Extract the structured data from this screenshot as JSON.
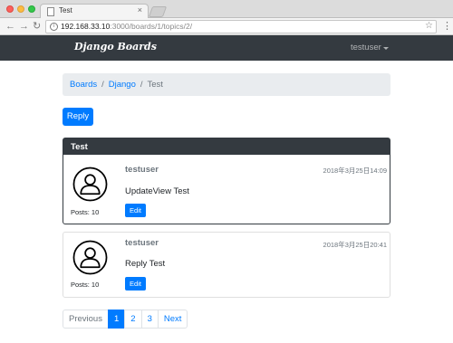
{
  "browser": {
    "tab_title": "Test",
    "tab_close": "×",
    "url_host": "192.168.33.10",
    "url_rest": ":3000/boards/1/topics/2/",
    "back_icon": "arrow-left-icon",
    "forward_icon": "arrow-right-icon",
    "reload_icon": "reload-icon",
    "bookmark_icon": "star-icon",
    "menu_icon": "menu-dots-icon",
    "info_glyph": "i"
  },
  "navbar": {
    "brand": "Django Boards",
    "user": "testuser",
    "background": "#343a40"
  },
  "breadcrumb": {
    "items": [
      "Boards",
      "Django"
    ],
    "separator": "/",
    "active": "Test"
  },
  "reply_button": "Reply",
  "posts": [
    {
      "header": "Test",
      "author": "testuser",
      "timestamp": "2018年3月25日14:09",
      "message": "UpdateView Test",
      "posts_count": "Posts: 10",
      "edit_label": "Edit"
    },
    {
      "author": "testuser",
      "timestamp": "2018年3月25日20:41",
      "message": "Reply Test",
      "posts_count": "Posts: 10",
      "edit_label": "Edit"
    }
  ],
  "pagination": {
    "previous": "Previous",
    "pages": [
      "1",
      "2",
      "3"
    ],
    "current": "1",
    "next": "Next"
  },
  "colors": {
    "primary": "#007bff",
    "dark": "#343a40",
    "breadcrumb_bg": "#e9ecef"
  }
}
